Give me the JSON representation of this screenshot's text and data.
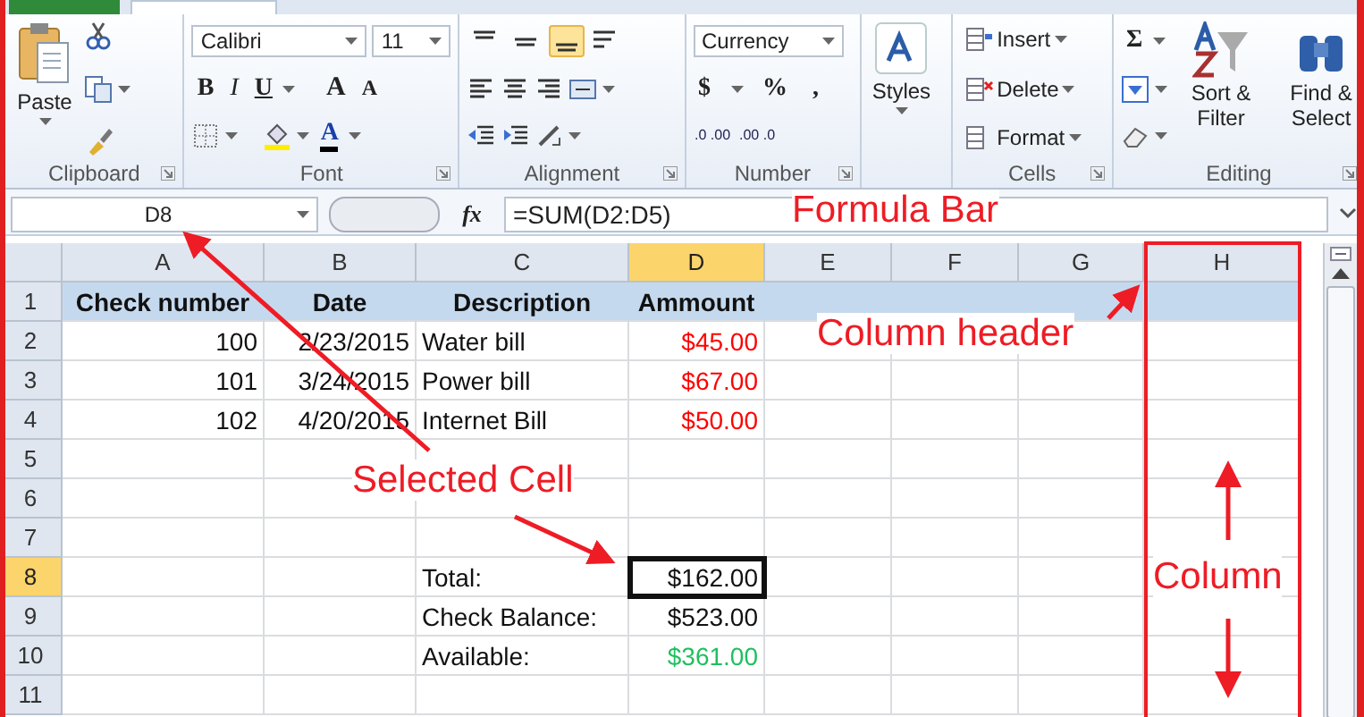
{
  "ribbon": {
    "clipboard": {
      "label": "Clipboard",
      "paste": "Paste"
    },
    "font": {
      "label": "Font",
      "font_name": "Calibri",
      "font_size": "11",
      "format_buttons": [
        {
          "label": "B"
        },
        {
          "label": "I"
        },
        {
          "label": "U"
        }
      ],
      "size_buttons": [
        {
          "label": "A"
        },
        {
          "label": "A"
        }
      ],
      "font_color": {
        "label": "A"
      }
    },
    "alignment": {
      "label": "Alignment",
      "vertical_align": [
        {
          "selected": false
        },
        {
          "selected": false
        },
        {
          "selected": true
        }
      ]
    },
    "number": {
      "label": "Number",
      "format": "Currency",
      "symbols": [
        {
          "label": "$"
        },
        {
          "label": "%"
        },
        {
          "label": ","
        }
      ],
      "decimal_buttons": [
        {
          "label": ".0 .00"
        },
        {
          "label": ".00 .0"
        }
      ]
    },
    "styles": {
      "label": "Styles"
    },
    "cells": {
      "label": "Cells",
      "buttons": [
        {
          "label": "Insert"
        },
        {
          "label": "Delete"
        },
        {
          "label": "Format"
        }
      ]
    },
    "editing": {
      "label": "Editing",
      "sum": "Σ",
      "sort": "Sort & Filter",
      "find": "Find & Select"
    }
  },
  "formula_bar": {
    "name_box": "D8",
    "function_label": "fx",
    "formula": "=SUM(D2:D5)"
  },
  "sheet": {
    "columns": [
      {
        "label": "A",
        "selected": false
      },
      {
        "label": "B",
        "selected": false
      },
      {
        "label": "C",
        "selected": false
      },
      {
        "label": "D",
        "selected": true
      },
      {
        "label": "E",
        "selected": false
      },
      {
        "label": "F",
        "selected": false
      },
      {
        "label": "G",
        "selected": false
      },
      {
        "label": "H",
        "selected": false
      }
    ],
    "rows": [
      {
        "number": "1",
        "selected": false,
        "kind": "header",
        "cells": {
          "A": {
            "text": "Check number",
            "selected": false
          },
          "B": {
            "text": "Date",
            "selected": false
          },
          "C": {
            "text": "Description",
            "selected": false
          },
          "D": {
            "text": "Ammount",
            "selected": false
          }
        }
      },
      {
        "number": "2",
        "selected": false,
        "kind": "data",
        "cells": {
          "A": {
            "text": "100",
            "kind": "number",
            "selected": false
          },
          "B": {
            "text": "2/23/2015",
            "kind": "number",
            "selected": false
          },
          "C": {
            "text": "Water bill",
            "kind": "text",
            "selected": false
          },
          "D": {
            "text": "$45.00",
            "kind": "number",
            "color": "#ff0000",
            "selected": false
          }
        }
      },
      {
        "number": "3",
        "selected": false,
        "kind": "data",
        "cells": {
          "A": {
            "text": "101",
            "kind": "number",
            "selected": false
          },
          "B": {
            "text": "3/24/2015",
            "kind": "number",
            "selected": false
          },
          "C": {
            "text": "Power bill",
            "kind": "text",
            "selected": false
          },
          "D": {
            "text": "$67.00",
            "kind": "number",
            "color": "#ff0000",
            "selected": false
          }
        }
      },
      {
        "number": "4",
        "selected": false,
        "kind": "data",
        "cells": {
          "A": {
            "text": "102",
            "kind": "number",
            "selected": false
          },
          "B": {
            "text": "4/20/2015",
            "kind": "number",
            "selected": false
          },
          "C": {
            "text": "Internet Bill",
            "kind": "text",
            "selected": false
          },
          "D": {
            "text": "$50.00",
            "kind": "number",
            "color": "#ff0000",
            "selected": false
          }
        }
      },
      {
        "number": "5",
        "selected": false,
        "kind": "data"
      },
      {
        "number": "6",
        "selected": false,
        "kind": "data"
      },
      {
        "number": "7",
        "selected": false,
        "kind": "data"
      },
      {
        "number": "8",
        "selected": true,
        "kind": "data",
        "cells": {
          "C": {
            "text": "Total:",
            "kind": "text",
            "selected": false
          },
          "D": {
            "text": "$162.00",
            "kind": "number",
            "selected": true
          }
        }
      },
      {
        "number": "9",
        "selected": false,
        "kind": "data",
        "cells": {
          "C": {
            "text": "Check Balance:",
            "kind": "text",
            "selected": false
          },
          "D": {
            "text": "$523.00",
            "kind": "number",
            "selected": false
          }
        }
      },
      {
        "number": "10",
        "selected": false,
        "kind": "data",
        "cells": {
          "C": {
            "text": "Available:",
            "kind": "text",
            "selected": false
          },
          "D": {
            "text": "$361.00",
            "kind": "number",
            "color": "#1fbf5f",
            "selected": false
          }
        }
      },
      {
        "number": "11",
        "selected": false,
        "kind": "data"
      }
    ]
  },
  "annotations": [
    {
      "text": "Formula Bar"
    },
    {
      "text": "Column header"
    },
    {
      "text": "Selected Cell"
    },
    {
      "text": "Column"
    }
  ]
}
